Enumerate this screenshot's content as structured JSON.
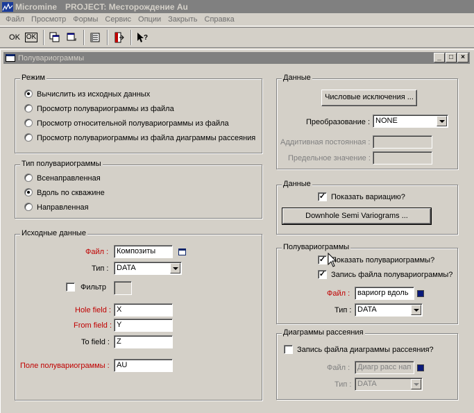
{
  "app": {
    "name": "Micromine",
    "project_title": "PROJECT: Месторождение Au"
  },
  "menu": [
    "Файл",
    "Просмотр",
    "Формы",
    "Сервис",
    "Опции",
    "Закрыть",
    "Справка"
  ],
  "toolbar": {
    "ok_label": "OK",
    "ok_boxed_label": "OK"
  },
  "dialog": {
    "title": "Полувариограммы"
  },
  "mode": {
    "title": "Режим",
    "options": [
      "Вычислить из исходных данных",
      "Просмотр полувариограммы из файла",
      "Просмотр относительной полувариограммы из файла",
      "Просмотр полувариограммы из файла диаграммы рассеяния"
    ],
    "selected_index": 0
  },
  "variogram_type": {
    "title": "Тип полувариограммы",
    "options": [
      "Всенаправленная",
      "Вдоль по скважине",
      "Направленная"
    ],
    "selected_index": 1
  },
  "input_data": {
    "title": "Исходные данные",
    "file_label": "Файл :",
    "file_value": "Композиты",
    "type_label": "Тип :",
    "type_value": "DATA",
    "filter_label": "Фильтр",
    "filter_checked": false,
    "hole_field_label": "Hole field :",
    "hole_field_value": "X",
    "from_field_label": "From field :",
    "from_field_value": "Y",
    "to_field_label": "To field :",
    "to_field_value": "Z",
    "variogram_field_label": "Поле полувариограммы :",
    "variogram_field_value": "AU"
  },
  "data_panel": {
    "title": "Данные",
    "numeric_exclusions_button": "Числовые исключения ...",
    "transform_label": "Преобразование :",
    "transform_value": "NONE",
    "additive_const_label": "Аддитивная постоянная :",
    "limit_value_label": "Предельное значение :"
  },
  "data_panel2": {
    "title": "Данные",
    "show_variation_label": "Показать вариацию?",
    "show_variation_checked": true,
    "downhole_button": "Downhole Semi Variograms ..."
  },
  "variograms_panel": {
    "title": "Полувариограммы",
    "show_label": "Показать полувариограммы?",
    "show_checked": true,
    "write_file_label": "Запись файла полувариограммы?",
    "write_file_checked": true,
    "file_label": "Файл :",
    "file_value": "вариогр вдоль",
    "type_label": "Тип :",
    "type_value": "DATA"
  },
  "scatter_panel": {
    "title": "Диаграммы рассеяния",
    "write_file_label": "Запись файла диаграммы рассеяния?",
    "write_file_checked": false,
    "file_label": "Файл :",
    "file_value": "Диагр расс нап",
    "type_label": "Тип :",
    "type_value": "DATA"
  }
}
